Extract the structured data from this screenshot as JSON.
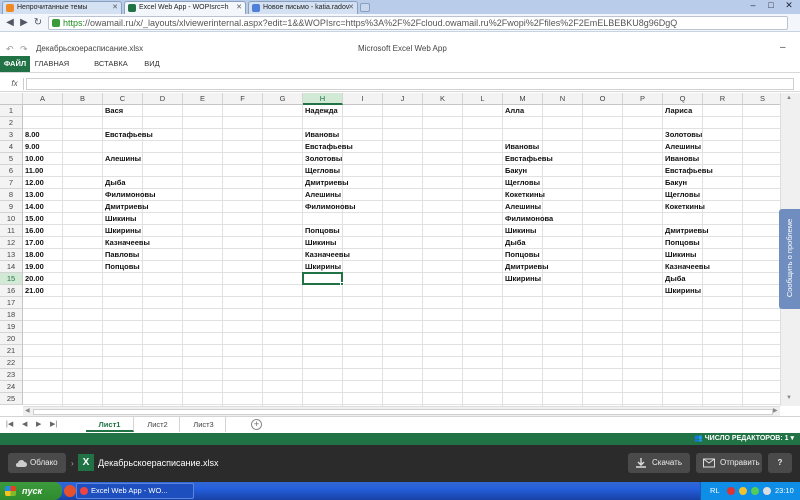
{
  "browser": {
    "tabs": [
      {
        "label": "Непрочитанные темы"
      },
      {
        "label": "Excel Web App - WOPIsrc=h"
      },
      {
        "label": "Новое письмо - katia.radov"
      }
    ],
    "url_https": "https",
    "url_rest": "://owamail.ru/x/_layouts/xlviewerinternal.aspx?edit=1&&WOPIsrc=https%3A%2F%2Fcloud.owamail.ru%2Fwopi%2Ffiles%2F2EmELBEBKU8g96DgQ"
  },
  "app": {
    "file_name": "Декабрьскоерасписание.xlsx",
    "app_name": "Microsoft Excel Web App"
  },
  "ribbon": {
    "tabs": [
      "ФАЙЛ",
      "ГЛАВНАЯ",
      "ВСТАВКА",
      "ВИД"
    ]
  },
  "formula_bar": {
    "fx_label": "fx"
  },
  "grid": {
    "columns": [
      "A",
      "B",
      "C",
      "D",
      "E",
      "F",
      "G",
      "H",
      "I",
      "J",
      "K",
      "L",
      "M",
      "N",
      "O",
      "P",
      "Q",
      "R",
      "S"
    ],
    "rows": [
      "1",
      "2",
      "3",
      "4",
      "5",
      "6",
      "7",
      "8",
      "9",
      "10",
      "11",
      "12",
      "13",
      "14",
      "15",
      "16",
      "17",
      "18",
      "19",
      "20",
      "21",
      "22",
      "23",
      "24",
      "25"
    ],
    "selected_column": "H",
    "selected_row": "15",
    "cells": {
      "C1": "Вася",
      "H1": "Надежда",
      "M1": "Алла",
      "Q1": "Лариса",
      "A3": "8.00",
      "C3": "Евстафьевы",
      "H3": "Ивановы",
      "Q3": "Золотовы",
      "A4": "9.00",
      "H4": "Евстафьевы",
      "M4": "Ивановы",
      "Q4": "Алешины",
      "A5": "10.00",
      "C5": "Алешины",
      "H5": "Золотовы",
      "M5": "Евстафьевы",
      "Q5": "Ивановы",
      "A6": "11.00",
      "H6": "Щегловы",
      "M6": "Бакун",
      "Q6": "Евстафьевы",
      "A7": "12.00",
      "C7": "Дыба",
      "H7": "Дмитриевы",
      "M7": "Щегловы",
      "Q7": "Бакун",
      "A8": "13.00",
      "C8": "Филимоновы",
      "H8": "Алешины",
      "M8": "Кокеткины",
      "Q8": "Щегловы",
      "A9": "14.00",
      "C9": "Дмитриевы",
      "H9": "Филимоновы",
      "M9": "Алешины",
      "Q9": "Кокеткины",
      "A10": "15.00",
      "C10": "Шикины",
      "M10": "Филимонова",
      "A11": "16.00",
      "C11": "Шкирины",
      "H11": "Попцовы",
      "M11": "Шикины",
      "Q11": "Дмитриевы",
      "A12": "17.00",
      "C12": "Казначеевы",
      "H12": "Шикины",
      "M12": "Дыба",
      "Q12": "Попцовы",
      "A13": "18.00",
      "C13": "Павловы",
      "H13": "Казначеевы",
      "M13": "Попцовы",
      "Q13": "Шикины",
      "A14": "19.00",
      "C14": "Попцовы",
      "H14": "Шкирины",
      "M14": "Дмитриевы",
      "Q14": "Казначеевы",
      "A15": "20.00",
      "M15": "Шкирины",
      "Q15": "Дыба",
      "A16": "21.00",
      "Q16": "Шкирины"
    }
  },
  "feedback_label": "Сообщить о проблеме",
  "sheets": {
    "tabs": [
      "Лист1",
      "Лист2",
      "Лист3"
    ],
    "active": "Лист1"
  },
  "status": {
    "editors": "ЧИСЛО РЕДАКТОРОВ: 1"
  },
  "owa": {
    "cloud_label": "Облако",
    "file_name": "Декабрьскоерасписание.xlsx",
    "download_label": "Скачать",
    "send_label": "Отправить",
    "help_label": "?"
  },
  "taskbar": {
    "start_label": "пуск",
    "task_label": "Excel Web App - WO...",
    "lang": "RL",
    "clock": "23:10"
  },
  "colors": {
    "excel_green": "#217346",
    "selection_fill": "#d2e9d6",
    "feedback_blue": "#6f8ebf",
    "owa_dark": "#2b2b2b"
  },
  "icons": [
    "back-icon",
    "forward-icon",
    "refresh-icon",
    "undo-icon",
    "redo-icon",
    "cloud-icon",
    "excel-icon",
    "download-icon",
    "mail-icon",
    "help-icon",
    "editors-icon"
  ]
}
